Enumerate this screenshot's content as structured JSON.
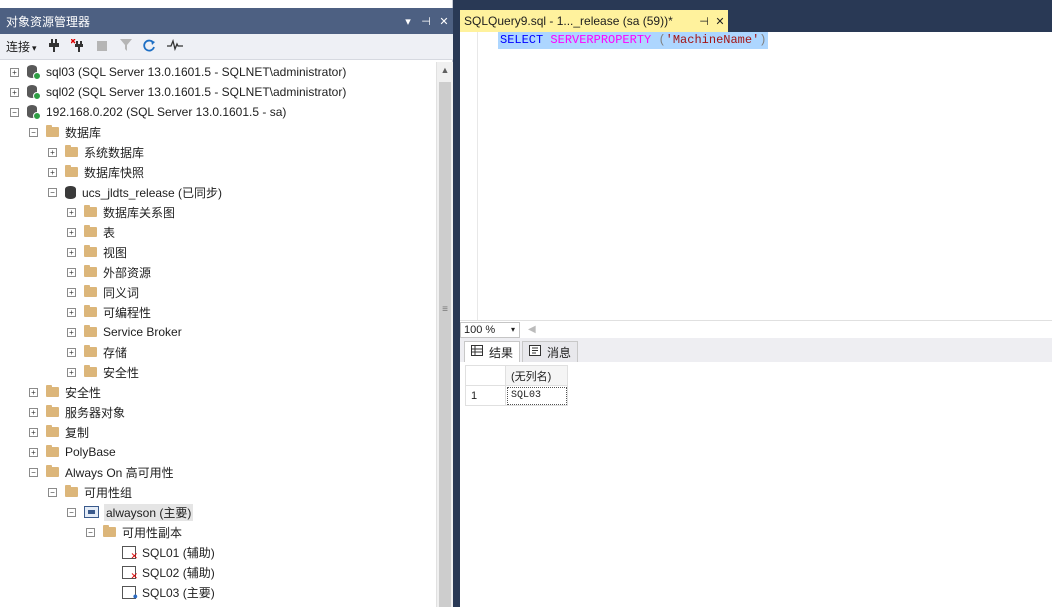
{
  "object_explorer": {
    "title": "对象资源管理器",
    "title_buttons": [
      "▾",
      "⊣",
      "✕"
    ],
    "toolbar": {
      "connect_label": "连接",
      "connect_caret": "▾"
    },
    "tree": [
      {
        "level": 0,
        "expander": "+",
        "icon": "server-icon",
        "label": "sql03 (SQL Server 13.0.1601.5 - SQLNET\\administrator)"
      },
      {
        "level": 0,
        "expander": "+",
        "icon": "server-icon",
        "label": "sql02 (SQL Server 13.0.1601.5 - SQLNET\\administrator)"
      },
      {
        "level": 0,
        "expander": "−",
        "icon": "server-icon",
        "label": "192.168.0.202 (SQL Server 13.0.1601.5 - sa)"
      },
      {
        "level": 1,
        "expander": "−",
        "icon": "folder-icon",
        "label": "数据库"
      },
      {
        "level": 2,
        "expander": "+",
        "icon": "folder-icon",
        "label": "系统数据库"
      },
      {
        "level": 2,
        "expander": "+",
        "icon": "folder-icon",
        "label": "数据库快照"
      },
      {
        "level": 2,
        "expander": "−",
        "icon": "database-icon",
        "label": "ucs_jldts_release (已同步)"
      },
      {
        "level": 3,
        "expander": "+",
        "icon": "folder-icon",
        "label": "数据库关系图"
      },
      {
        "level": 3,
        "expander": "+",
        "icon": "folder-icon",
        "label": "表"
      },
      {
        "level": 3,
        "expander": "+",
        "icon": "folder-icon",
        "label": "视图"
      },
      {
        "level": 3,
        "expander": "+",
        "icon": "folder-icon",
        "label": "外部资源"
      },
      {
        "level": 3,
        "expander": "+",
        "icon": "folder-icon",
        "label": "同义词"
      },
      {
        "level": 3,
        "expander": "+",
        "icon": "folder-icon",
        "label": "可编程性"
      },
      {
        "level": 3,
        "expander": "+",
        "icon": "folder-icon",
        "label": "Service Broker"
      },
      {
        "level": 3,
        "expander": "+",
        "icon": "folder-icon",
        "label": "存储"
      },
      {
        "level": 3,
        "expander": "+",
        "icon": "folder-icon",
        "label": "安全性"
      },
      {
        "level": 1,
        "expander": "+",
        "icon": "folder-icon",
        "label": "安全性"
      },
      {
        "level": 1,
        "expander": "+",
        "icon": "folder-icon",
        "label": "服务器对象"
      },
      {
        "level": 1,
        "expander": "+",
        "icon": "folder-icon",
        "label": "复制"
      },
      {
        "level": 1,
        "expander": "+",
        "icon": "folder-icon",
        "label": "PolyBase"
      },
      {
        "level": 1,
        "expander": "−",
        "icon": "folder-icon",
        "label": "Always On 高可用性"
      },
      {
        "level": 2,
        "expander": "−",
        "icon": "folder-icon",
        "label": "可用性组"
      },
      {
        "level": 3,
        "expander": "−",
        "icon": "availability-group-icon",
        "label": "alwayson (主要)",
        "selected": true
      },
      {
        "level": 4,
        "expander": "−",
        "icon": "folder-icon",
        "label": "可用性副本"
      },
      {
        "level": 5,
        "expander": "",
        "icon": "replica-error-icon",
        "label": "SQL01 (辅助)"
      },
      {
        "level": 5,
        "expander": "",
        "icon": "replica-error-icon",
        "label": "SQL02 (辅助)"
      },
      {
        "level": 5,
        "expander": "",
        "icon": "replica-primary-icon",
        "label": "SQL03 (主要)"
      }
    ]
  },
  "editor": {
    "tab_title": "SQLQuery9.sql - 1..._release (sa (59))*",
    "tab_pin": "⊣",
    "tab_close": "✕",
    "code": {
      "keyword": "SELECT",
      "function": "SERVERPROPERTY",
      "open_paren": "(",
      "string": "'MachineName'",
      "close_paren": ")"
    },
    "zoom": "100 %",
    "zoom_caret": "▾"
  },
  "results": {
    "tabs": [
      {
        "icon": "grid-icon",
        "label": "结果",
        "active": true
      },
      {
        "icon": "messages-icon",
        "label": "消息",
        "active": false
      }
    ],
    "columns": [
      "(无列名)"
    ],
    "rows": [
      {
        "num": "1",
        "values": [
          "SQL03"
        ]
      }
    ]
  }
}
